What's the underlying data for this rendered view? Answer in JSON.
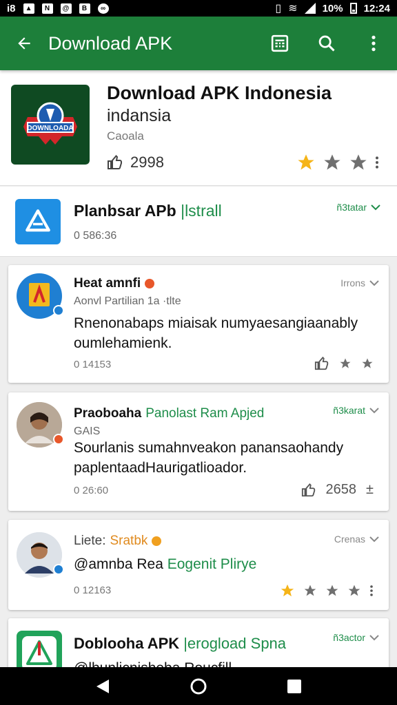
{
  "status_bar": {
    "battery": "10%",
    "time": "12:24"
  },
  "app_bar": {
    "title": "Download APK"
  },
  "header": {
    "title": "Download APK Indonesia",
    "subtitle": "indansia",
    "category": "Caoala",
    "likes": "2998",
    "rating_stars": 1,
    "logo_text": "DOWNLOADA",
    "logo_colors": {
      "bg": "#0f4a22",
      "red": "#d3262a",
      "blue": "#1e5cb0"
    }
  },
  "install_row": {
    "title": "Planbsar APb",
    "action": "|lstrall",
    "meta": "0 586:36",
    "right_label": "ñ3tatar"
  },
  "cards": [
    {
      "name": "Heat amnfi",
      "subtitle": "Aonvl Partilian 1a  ·tlte",
      "body": "Rnenonabaps miaisak numyaesangiaanably oumlehamienk.",
      "meta": "0 14153",
      "top_right": "Irrons"
    },
    {
      "name": "Praoboaha",
      "name_accent": "Panolast Ram Apjed",
      "subtitle": "GAIS",
      "body": "Sourlanis sumahnveakon panansaohandy paplentaadHaurigatlioador.",
      "meta": "0 26:60",
      "likes": "2658",
      "top_right": "ñ3karat"
    },
    {
      "name": "Liete:",
      "name_accent": "Sratbk",
      "body": "@amnba Rea",
      "body_accent": "Eogenit Plirye",
      "meta": "0 12163",
      "top_right": "Crenas",
      "rating_stars": 1
    },
    {
      "name": "Doblooha APK",
      "name_accent": "|erogload Spna",
      "body": "@lbunlicnisheba Roucfill",
      "top_right": "ñ3actor"
    }
  ],
  "colors": {
    "app_bar": "#1d7f3a",
    "accent_green": "#1e8d4a",
    "star_gold": "#f5b418",
    "star_grey": "#777777"
  }
}
